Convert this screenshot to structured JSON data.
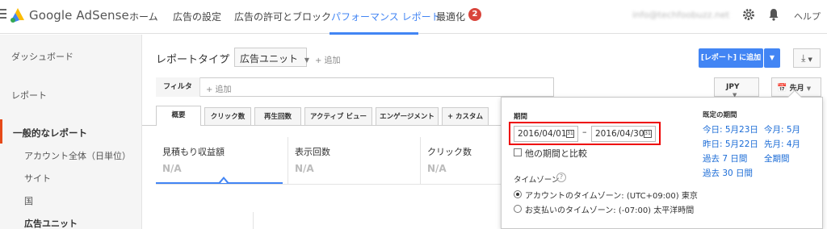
{
  "header": {
    "brand": "Google AdSense",
    "nav": [
      "ホーム",
      "広告の設定",
      "広告の許可とブロック",
      "パフォーマンス レポート",
      "最適化"
    ],
    "badge": "2",
    "email": "info@techfoobuzz.net",
    "help": "ヘルプ"
  },
  "sidebar": {
    "dashboard": "ダッシュボード",
    "report": "レポート",
    "common_reports": "一般的なレポート",
    "sub_items": [
      "アカウント全体（日単位）",
      "サイト",
      "国",
      "広告ユニット"
    ]
  },
  "main": {
    "crumb": "レポートタイプ",
    "crumb_sep": "›",
    "report_type": "広告ユニット",
    "add": "+ 追加",
    "add_report_btn": "[レポート] に追加",
    "filter": "フィルタ",
    "filter_add": "+ 追加",
    "currency": "JPY",
    "date_btn": "先月",
    "tabs": [
      "概要",
      "クリック数",
      "再生回数",
      "アクティブ ビュー",
      "エンゲージメント",
      "+ カスタム"
    ],
    "metrics": [
      {
        "label": "見積もり収益額",
        "value": "N/A"
      },
      {
        "label": "表示回数",
        "value": "N/A"
      },
      {
        "label": "クリック数",
        "value": "N/A"
      }
    ]
  },
  "date_popup": {
    "period_title": "期間",
    "start_date": "2016/04/01",
    "end_date": "2016/04/30",
    "dash": "–",
    "compare_label": "他の期間と比較",
    "timezone_title": "タイムゾーン",
    "tz_account": "アカウントのタイムゾーン: (UTC+09:00) 東京",
    "tz_payment": "お支払いのタイムゾーン: (-07:00) 太平洋時間",
    "presets_title": "既定の期間",
    "presets": [
      [
        "今日: 5月23日",
        "今月: 5月"
      ],
      [
        "昨日: 5月22日",
        "先月: 4月"
      ],
      [
        "過去 7 日間",
        "全期間"
      ],
      [
        "過去 30 日間",
        ""
      ]
    ],
    "cal_icon": "31"
  },
  "colors": {
    "accent": "#4285f4",
    "badge": "#d9453c",
    "highlight": "#e00000",
    "link": "#1a6bd6"
  }
}
